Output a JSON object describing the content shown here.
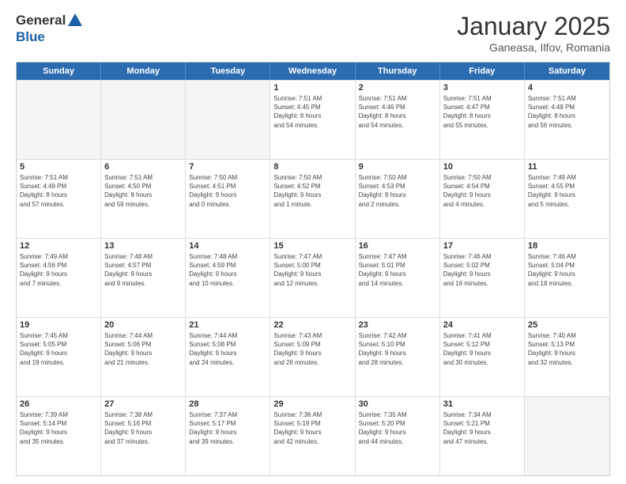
{
  "header": {
    "logo_general": "General",
    "logo_blue": "Blue",
    "title": "January 2025",
    "subtitle": "Ganeasa, Ilfov, Romania"
  },
  "days_of_week": [
    "Sunday",
    "Monday",
    "Tuesday",
    "Wednesday",
    "Thursday",
    "Friday",
    "Saturday"
  ],
  "weeks": [
    [
      {
        "day": "",
        "info": ""
      },
      {
        "day": "",
        "info": ""
      },
      {
        "day": "",
        "info": ""
      },
      {
        "day": "1",
        "info": "Sunrise: 7:51 AM\nSunset: 4:45 PM\nDaylight: 8 hours\nand 54 minutes."
      },
      {
        "day": "2",
        "info": "Sunrise: 7:51 AM\nSunset: 4:46 PM\nDaylight: 8 hours\nand 54 minutes."
      },
      {
        "day": "3",
        "info": "Sunrise: 7:51 AM\nSunset: 4:47 PM\nDaylight: 8 hours\nand 55 minutes."
      },
      {
        "day": "4",
        "info": "Sunrise: 7:51 AM\nSunset: 4:48 PM\nDaylight: 8 hours\nand 56 minutes."
      }
    ],
    [
      {
        "day": "5",
        "info": "Sunrise: 7:51 AM\nSunset: 4:49 PM\nDaylight: 8 hours\nand 57 minutes."
      },
      {
        "day": "6",
        "info": "Sunrise: 7:51 AM\nSunset: 4:50 PM\nDaylight: 8 hours\nand 59 minutes."
      },
      {
        "day": "7",
        "info": "Sunrise: 7:50 AM\nSunset: 4:51 PM\nDaylight: 9 hours\nand 0 minutes."
      },
      {
        "day": "8",
        "info": "Sunrise: 7:50 AM\nSunset: 4:52 PM\nDaylight: 9 hours\nand 1 minute."
      },
      {
        "day": "9",
        "info": "Sunrise: 7:50 AM\nSunset: 4:53 PM\nDaylight: 9 hours\nand 2 minutes."
      },
      {
        "day": "10",
        "info": "Sunrise: 7:50 AM\nSunset: 4:54 PM\nDaylight: 9 hours\nand 4 minutes."
      },
      {
        "day": "11",
        "info": "Sunrise: 7:49 AM\nSunset: 4:55 PM\nDaylight: 9 hours\nand 5 minutes."
      }
    ],
    [
      {
        "day": "12",
        "info": "Sunrise: 7:49 AM\nSunset: 4:56 PM\nDaylight: 9 hours\nand 7 minutes."
      },
      {
        "day": "13",
        "info": "Sunrise: 7:48 AM\nSunset: 4:57 PM\nDaylight: 9 hours\nand 9 minutes."
      },
      {
        "day": "14",
        "info": "Sunrise: 7:48 AM\nSunset: 4:59 PM\nDaylight: 9 hours\nand 10 minutes."
      },
      {
        "day": "15",
        "info": "Sunrise: 7:47 AM\nSunset: 5:00 PM\nDaylight: 9 hours\nand 12 minutes."
      },
      {
        "day": "16",
        "info": "Sunrise: 7:47 AM\nSunset: 5:01 PM\nDaylight: 9 hours\nand 14 minutes."
      },
      {
        "day": "17",
        "info": "Sunrise: 7:46 AM\nSunset: 5:02 PM\nDaylight: 9 hours\nand 16 minutes."
      },
      {
        "day": "18",
        "info": "Sunrise: 7:46 AM\nSunset: 5:04 PM\nDaylight: 9 hours\nand 18 minutes."
      }
    ],
    [
      {
        "day": "19",
        "info": "Sunrise: 7:45 AM\nSunset: 5:05 PM\nDaylight: 9 hours\nand 19 minutes."
      },
      {
        "day": "20",
        "info": "Sunrise: 7:44 AM\nSunset: 5:06 PM\nDaylight: 9 hours\nand 21 minutes."
      },
      {
        "day": "21",
        "info": "Sunrise: 7:44 AM\nSunset: 5:08 PM\nDaylight: 9 hours\nand 24 minutes."
      },
      {
        "day": "22",
        "info": "Sunrise: 7:43 AM\nSunset: 5:09 PM\nDaylight: 9 hours\nand 26 minutes."
      },
      {
        "day": "23",
        "info": "Sunrise: 7:42 AM\nSunset: 5:10 PM\nDaylight: 9 hours\nand 28 minutes."
      },
      {
        "day": "24",
        "info": "Sunrise: 7:41 AM\nSunset: 5:12 PM\nDaylight: 9 hours\nand 30 minutes."
      },
      {
        "day": "25",
        "info": "Sunrise: 7:40 AM\nSunset: 5:13 PM\nDaylight: 9 hours\nand 32 minutes."
      }
    ],
    [
      {
        "day": "26",
        "info": "Sunrise: 7:39 AM\nSunset: 5:14 PM\nDaylight: 9 hours\nand 35 minutes."
      },
      {
        "day": "27",
        "info": "Sunrise: 7:38 AM\nSunset: 5:16 PM\nDaylight: 9 hours\nand 37 minutes."
      },
      {
        "day": "28",
        "info": "Sunrise: 7:37 AM\nSunset: 5:17 PM\nDaylight: 9 hours\nand 39 minutes."
      },
      {
        "day": "29",
        "info": "Sunrise: 7:36 AM\nSunset: 5:19 PM\nDaylight: 9 hours\nand 42 minutes."
      },
      {
        "day": "30",
        "info": "Sunrise: 7:35 AM\nSunset: 5:20 PM\nDaylight: 9 hours\nand 44 minutes."
      },
      {
        "day": "31",
        "info": "Sunrise: 7:34 AM\nSunset: 5:21 PM\nDaylight: 9 hours\nand 47 minutes."
      },
      {
        "day": "",
        "info": ""
      }
    ]
  ]
}
